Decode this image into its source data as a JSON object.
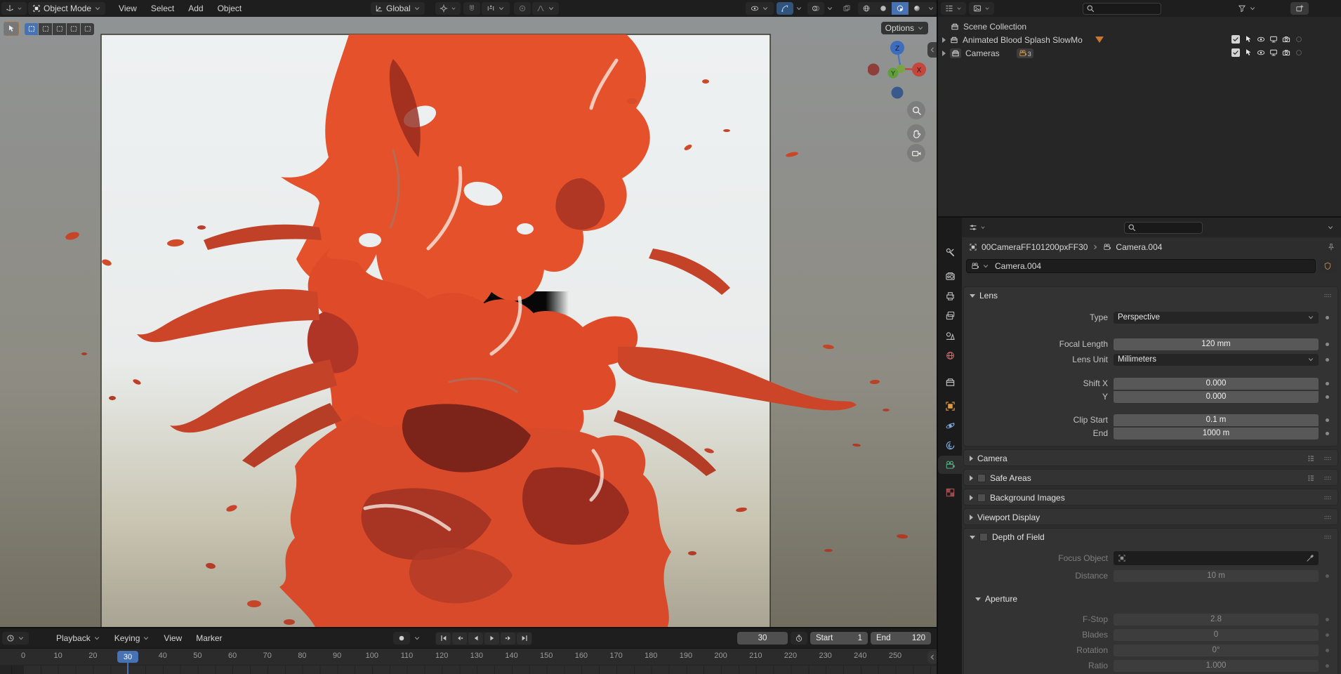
{
  "viewport_header": {
    "mode": "Object Mode",
    "menus": {
      "view": "View",
      "select": "Select",
      "add": "Add",
      "object": "Object"
    },
    "orientation": "Global"
  },
  "viewport": {
    "options": "Options",
    "gizmo": {
      "x": "X",
      "y": "Y",
      "z": "Z"
    }
  },
  "outliner": {
    "scene_collection": "Scene Collection",
    "collection1": "Animated Blood Splash SlowMo",
    "collection2": "Cameras",
    "collection2_count": "3"
  },
  "properties": {
    "breadcrumb": {
      "object": "00CameraFF101200pxFF30",
      "data": "Camera.004"
    },
    "name_field": "Camera.004",
    "lens": {
      "title": "Lens",
      "type_label": "Type",
      "type_value": "Perspective",
      "focal_label": "Focal Length",
      "focal_value": "120 mm",
      "unit_label": "Lens Unit",
      "unit_value": "Millimeters",
      "shiftx_label": "Shift X",
      "shiftx_value": "0.000",
      "shifty_label": "Y",
      "shifty_value": "0.000",
      "clip_label": "Clip Start",
      "clip_value": "0.1 m",
      "end_label": "End",
      "end_value": "1000 m"
    },
    "panels": {
      "camera": "Camera",
      "safe_areas": "Safe Areas",
      "background_images": "Background Images",
      "viewport_display": "Viewport Display",
      "depth_of_field": "Depth of Field"
    },
    "dof": {
      "focus_label": "Focus Object",
      "distance_label": "Distance",
      "distance_value": "10 m",
      "aperture_title": "Aperture",
      "fstop_label": "F-Stop",
      "fstop_value": "2.8",
      "blades_label": "Blades",
      "blades_value": "0",
      "rotation_label": "Rotation",
      "rotation_value": "0°",
      "ratio_label": "Ratio",
      "ratio_value": "1.000"
    }
  },
  "timeline": {
    "menus": {
      "playback": "Playback",
      "keying": "Keying",
      "view": "View",
      "marker": "Marker"
    },
    "current_frame": "30",
    "start_label": "Start",
    "start_value": "1",
    "end_label": "End",
    "end_value": "120",
    "ruler_ticks": [
      "0",
      "10",
      "20",
      "30",
      "40",
      "50",
      "60",
      "70",
      "80",
      "90",
      "100",
      "110",
      "120",
      "130",
      "140",
      "150",
      "160",
      "170",
      "180",
      "190",
      "200",
      "210",
      "220",
      "230",
      "240",
      "250"
    ]
  },
  "colors": {
    "accent_blue": "#4772b3",
    "splash_orange": "#e5512b",
    "splash_deep_red": "#8e2a20",
    "object_orange": "#dd9b44",
    "camera_data_green": "#54b889"
  }
}
